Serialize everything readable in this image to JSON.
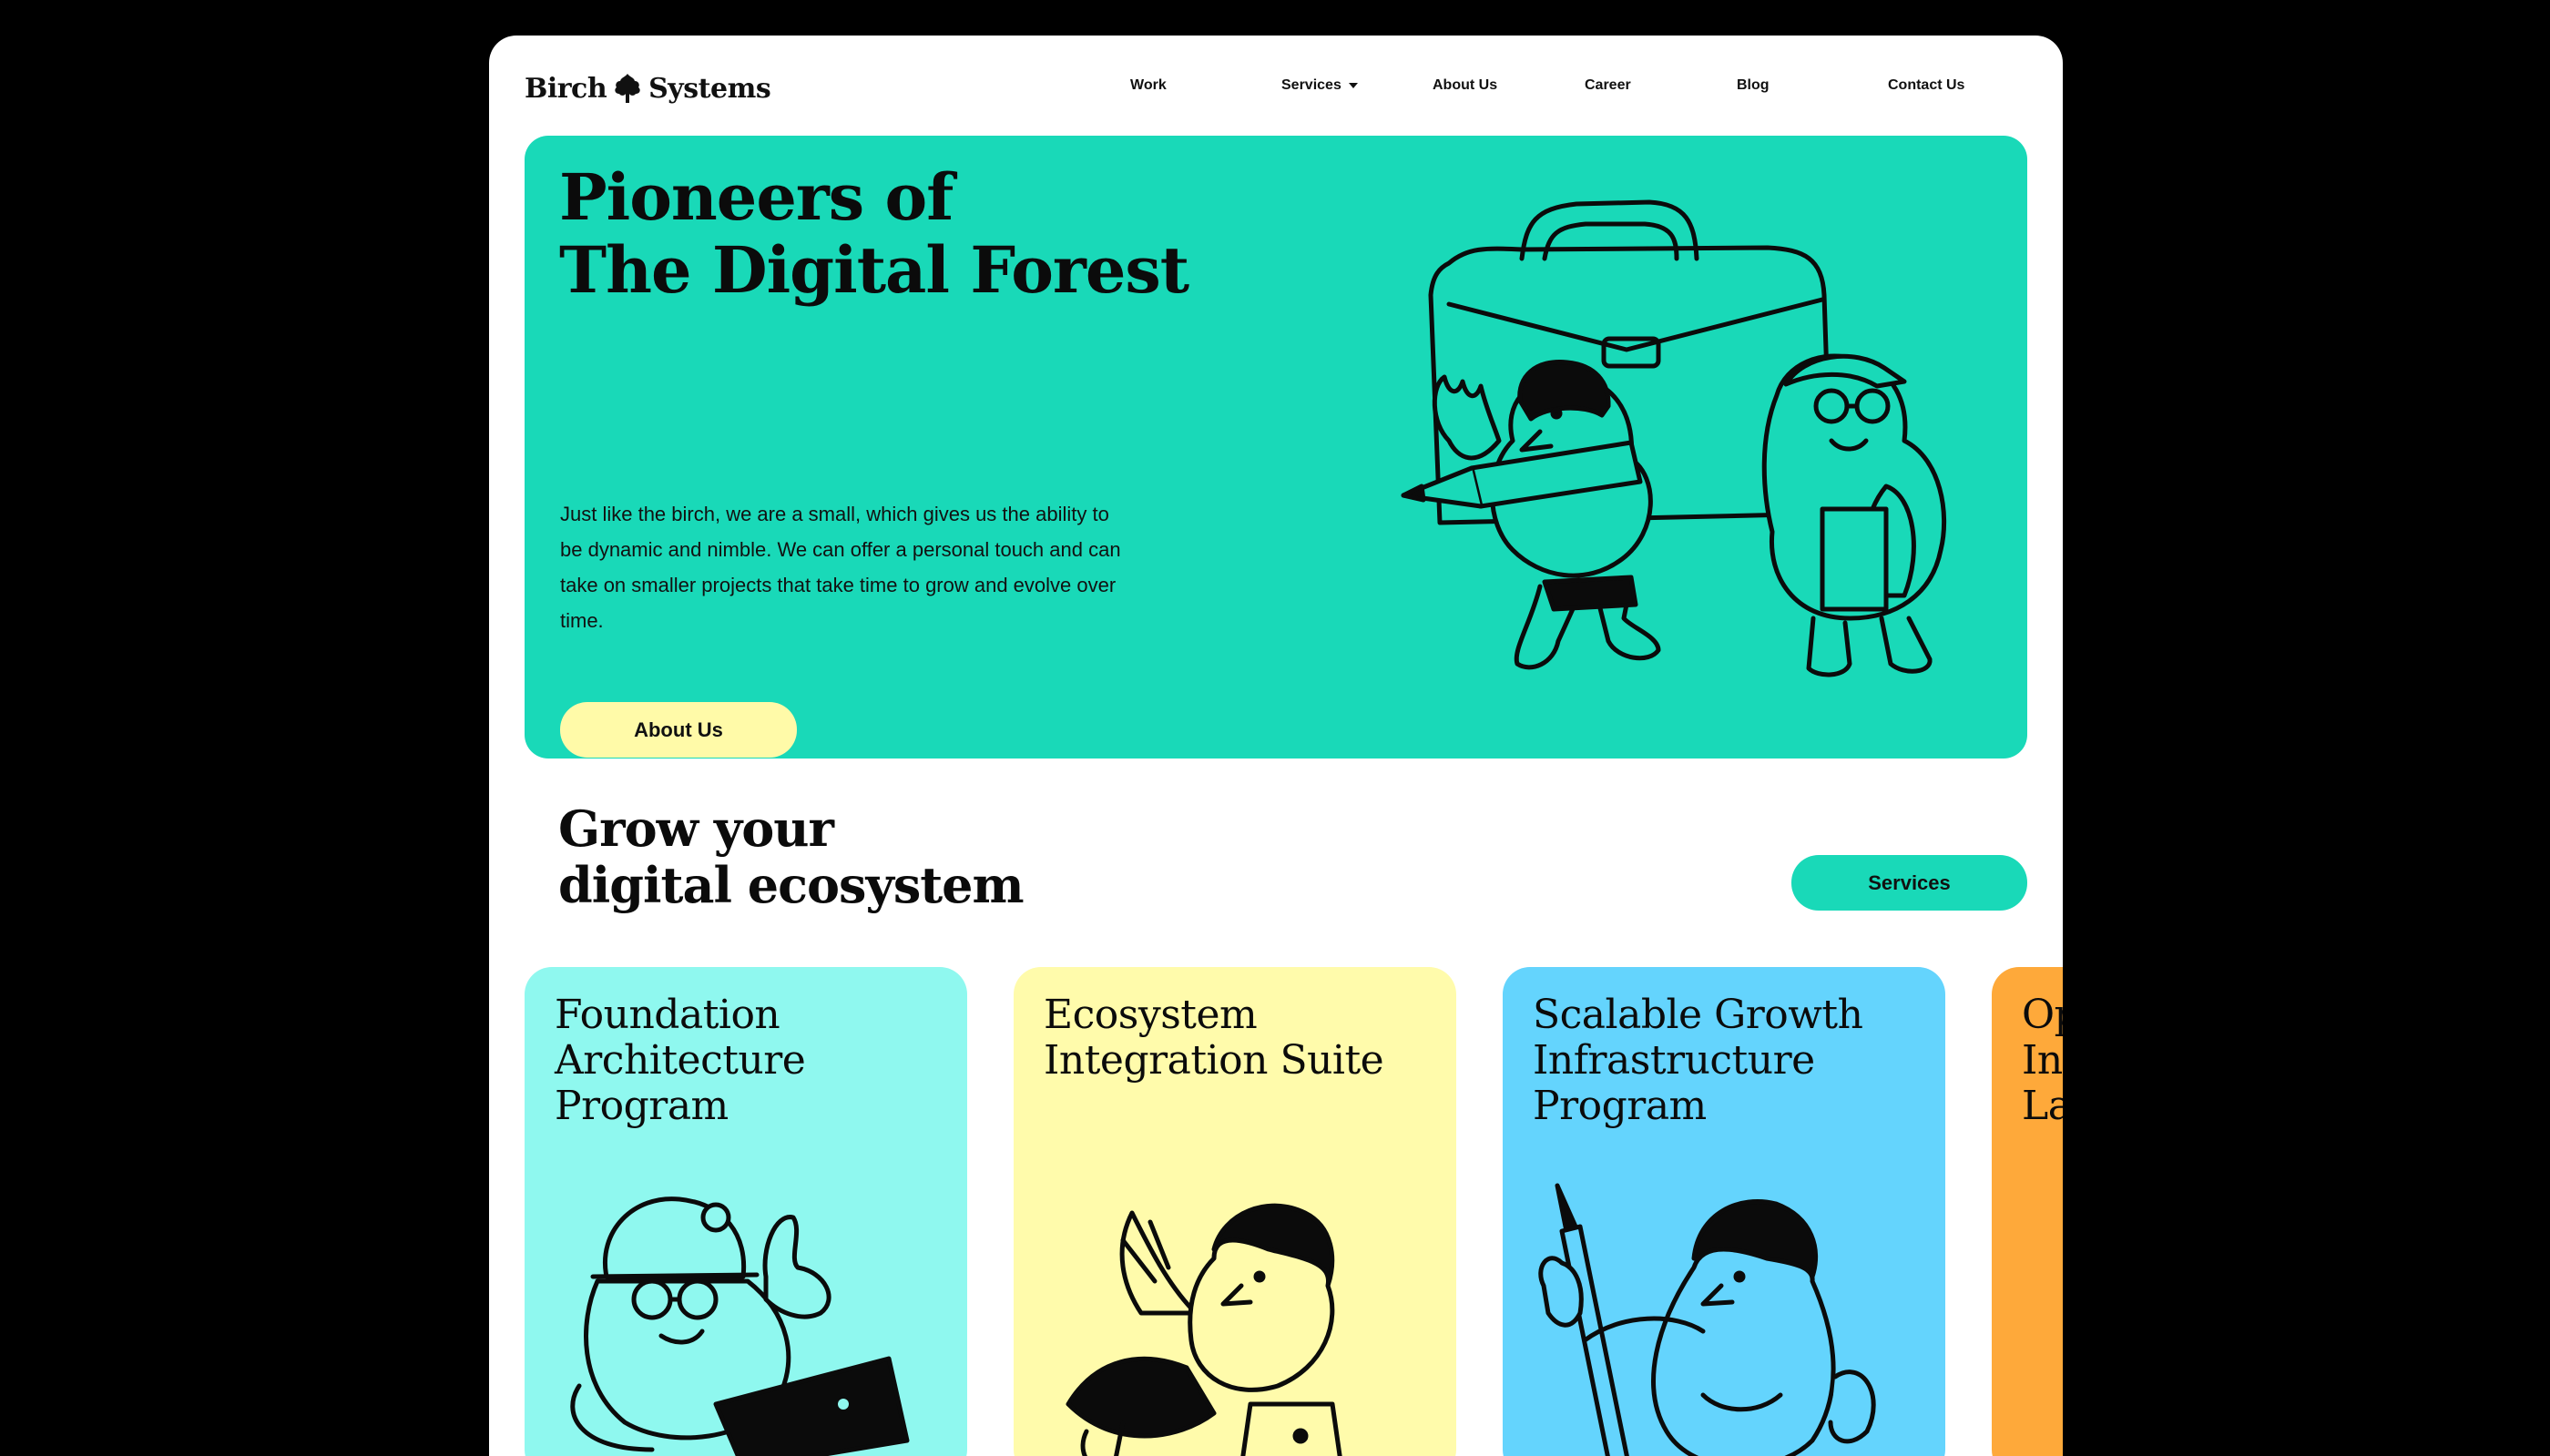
{
  "brand": {
    "name_left": "Birch",
    "name_right": "Systems"
  },
  "nav": {
    "work": "Work",
    "services": "Services",
    "about": "About Us",
    "career": "Career",
    "blog": "Blog",
    "contact": "Contact Us"
  },
  "hero": {
    "title_line1": "Pioneers of",
    "title_line2": "The Digital Forest",
    "body": "Just like the birch, we are a small, which gives us the ability to be dynamic and nimble. We can offer a personal touch and can take on smaller projects that take time to grow and evolve over time.",
    "button": "About Us"
  },
  "section": {
    "title_line1": "Grow your",
    "title_line2": "digital ecosystem",
    "button": "Services"
  },
  "cards": [
    {
      "lines": [
        "Foundation",
        "Architecture",
        "Program"
      ],
      "color": "#8ff8ef"
    },
    {
      "lines": [
        "Ecosystem",
        "Integration Suite"
      ],
      "color": "#fffbab"
    },
    {
      "lines": [
        "Scalable Growth",
        "Infrastructure",
        "Program"
      ],
      "color": "#64d4fd"
    },
    {
      "lines": [
        "Op",
        "In",
        "La"
      ],
      "color": "#fea93a"
    }
  ],
  "colors": {
    "accent": "#19d9b8",
    "button_light": "#fffaa8",
    "background": "#000000"
  }
}
